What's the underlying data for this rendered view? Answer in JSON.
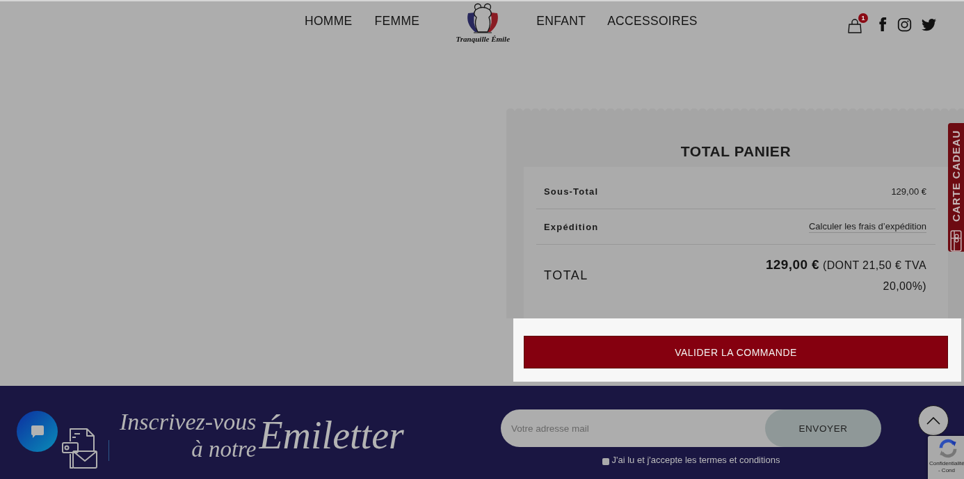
{
  "header": {
    "nav_left": [
      {
        "label": "HOMME"
      },
      {
        "label": "FEMME"
      }
    ],
    "logo": {
      "text": "Tranquille Émile"
    },
    "nav_right": [
      {
        "label": "ENFANT"
      },
      {
        "label": "ACCESSOIRES"
      }
    ],
    "cart": {
      "count": "1"
    }
  },
  "cart_totals": {
    "title": "TOTAL PANIER",
    "rows": [
      {
        "kind": "line",
        "label": "Sous-Total",
        "value": "129,00 €"
      },
      {
        "kind": "link",
        "label": "Expédition",
        "value": "Calculer les frais d’expédition"
      }
    ],
    "total": {
      "label": "TOTAL",
      "value": "**129,00 €** (DONT 21,50 € TVA 20,00%)"
    },
    "checkout_button": "VALIDER LA COMMANDE"
  },
  "gift_tab": {
    "label": "CARTE CADEAU"
  },
  "newsletter": {
    "heading_line_1": "Inscrivez-vous",
    "heading_line_2": "à notre",
    "heading_brand": "Émiletter",
    "placeholder": "Votre adresse mail",
    "submit": "ENVOYER",
    "consent": {
      "label": "J'ai lu et j'accepte les termes et conditions",
      "checked": false
    }
  },
  "privacy_badge": {
    "text": "Confidentialité - Cond"
  }
}
